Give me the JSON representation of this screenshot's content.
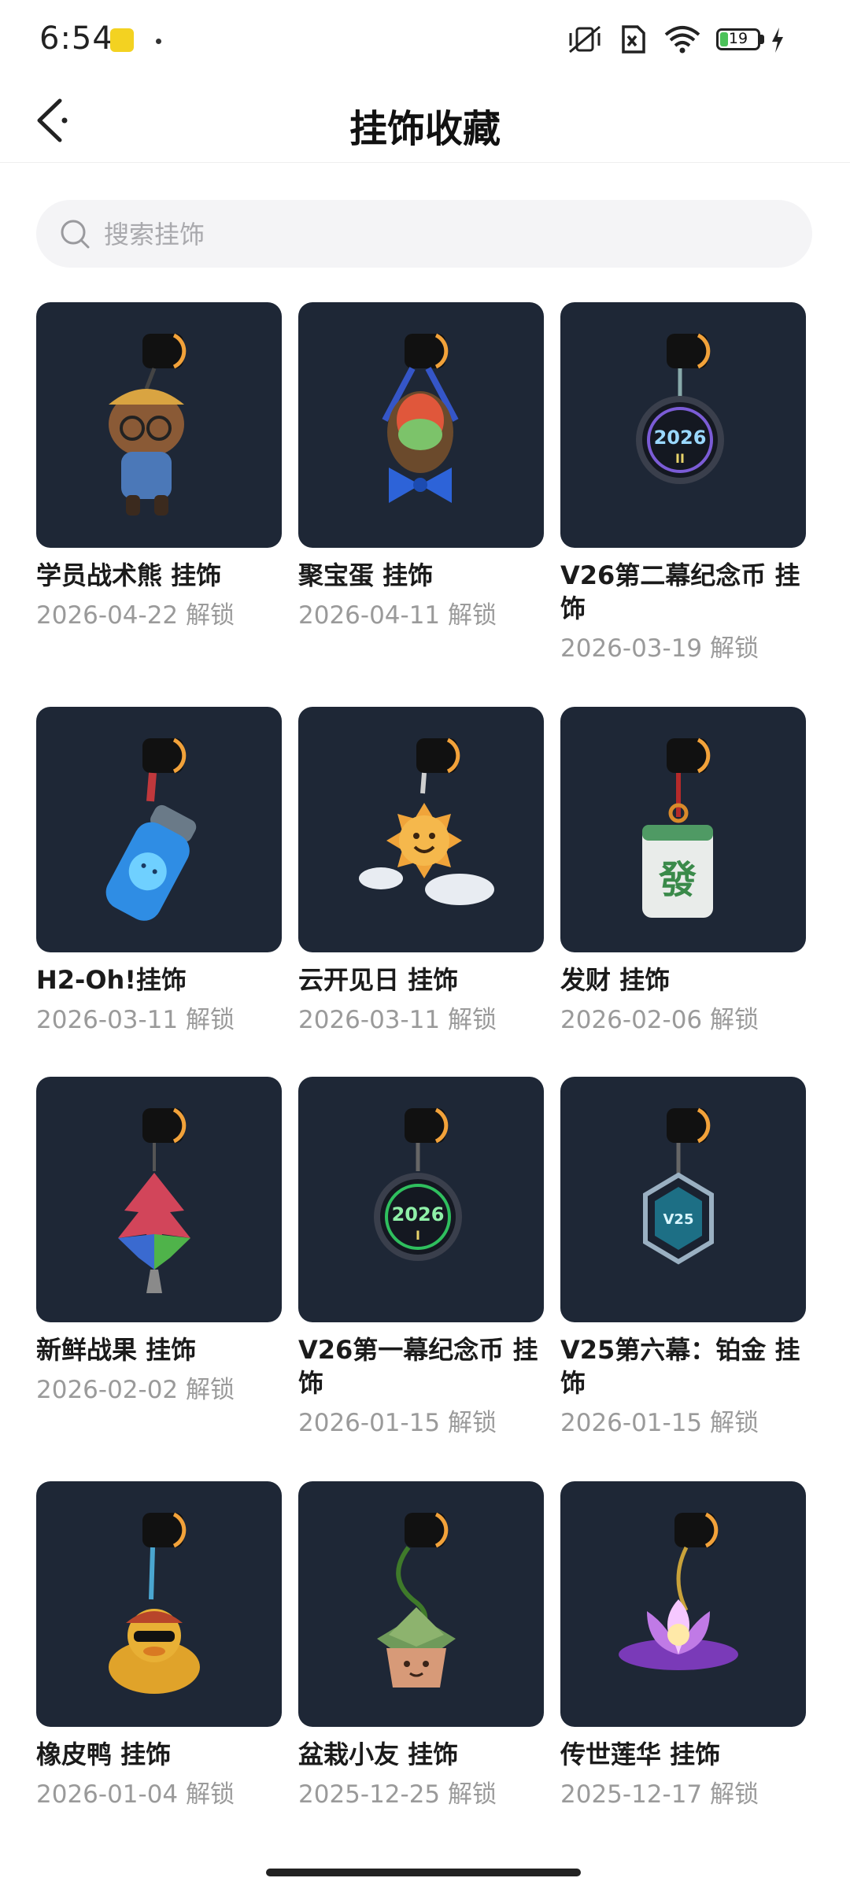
{
  "status_bar": {
    "time": "6:54",
    "battery": "19"
  },
  "header": {
    "title": "挂饰收藏"
  },
  "search": {
    "placeholder": "搜索挂饰"
  },
  "items": [
    {
      "name": "学员战术熊 挂饰",
      "date": "2026-04-22",
      "action": "解锁",
      "icon": "tactical-bear-charm"
    },
    {
      "name": "聚宝蛋 挂饰",
      "date": "2026-04-11",
      "action": "解锁",
      "icon": "treasure-egg-charm"
    },
    {
      "name": "V26第二幕纪念币 挂饰",
      "date": "2026-03-19",
      "action": "解锁",
      "icon": "v26-act2-coin-charm"
    },
    {
      "name": "H2-Oh!挂饰",
      "date": "2026-03-11",
      "action": "解锁",
      "icon": "water-bottle-charm"
    },
    {
      "name": "云开见日 挂饰",
      "date": "2026-03-11",
      "action": "解锁",
      "icon": "sun-cloud-charm"
    },
    {
      "name": "发财 挂饰",
      "date": "2026-02-06",
      "action": "解锁",
      "icon": "mahjong-tile-charm"
    },
    {
      "name": "新鲜战果 挂饰",
      "date": "2026-02-02",
      "action": "解锁",
      "icon": "leaf-charm"
    },
    {
      "name": "V26第一幕纪念币 挂饰",
      "date": "2026-01-15",
      "action": "解锁",
      "icon": "v26-act1-coin-charm"
    },
    {
      "name": "V25第六幕：铂金 挂饰",
      "date": "2026-01-15",
      "action": "解锁",
      "icon": "v25-platinum-charm"
    },
    {
      "name": "橡皮鸭 挂饰",
      "date": "2026-01-04",
      "action": "解锁",
      "icon": "rubber-duck-charm"
    },
    {
      "name": "盆栽小友 挂饰",
      "date": "2025-12-25",
      "action": "解锁",
      "icon": "succulent-pot-charm"
    },
    {
      "name": "传世莲华 挂饰",
      "date": "2025-12-17",
      "action": "解锁",
      "icon": "lotus-charm"
    }
  ],
  "colors": {
    "thumb_bg": "#1e2736",
    "accent_orange": "#f2a23a",
    "date_gray": "#9a9a9a"
  }
}
